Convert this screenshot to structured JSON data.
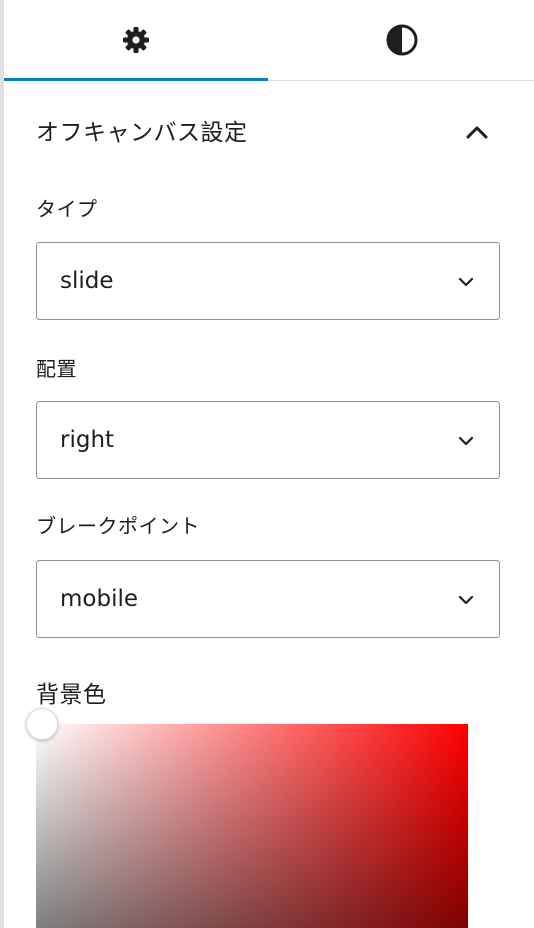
{
  "tabs": [
    {
      "name": "settings",
      "icon": "gear-icon",
      "active": true
    },
    {
      "name": "styles",
      "icon": "half-circle-contrast-icon",
      "active": false
    }
  ],
  "section": {
    "title": "オフキャンバス設定",
    "expanded": true
  },
  "fields": {
    "type": {
      "label": "タイプ",
      "value": "slide"
    },
    "placement": {
      "label": "配置",
      "value": "right"
    },
    "breakpoint": {
      "label": "ブレークポイント",
      "value": "mobile"
    }
  },
  "background": {
    "label": "背景色",
    "hue_color": "#ff0000"
  },
  "colors": {
    "accent": "#0a7bbf",
    "border": "#8c8f94",
    "text": "#1e1e1e"
  }
}
